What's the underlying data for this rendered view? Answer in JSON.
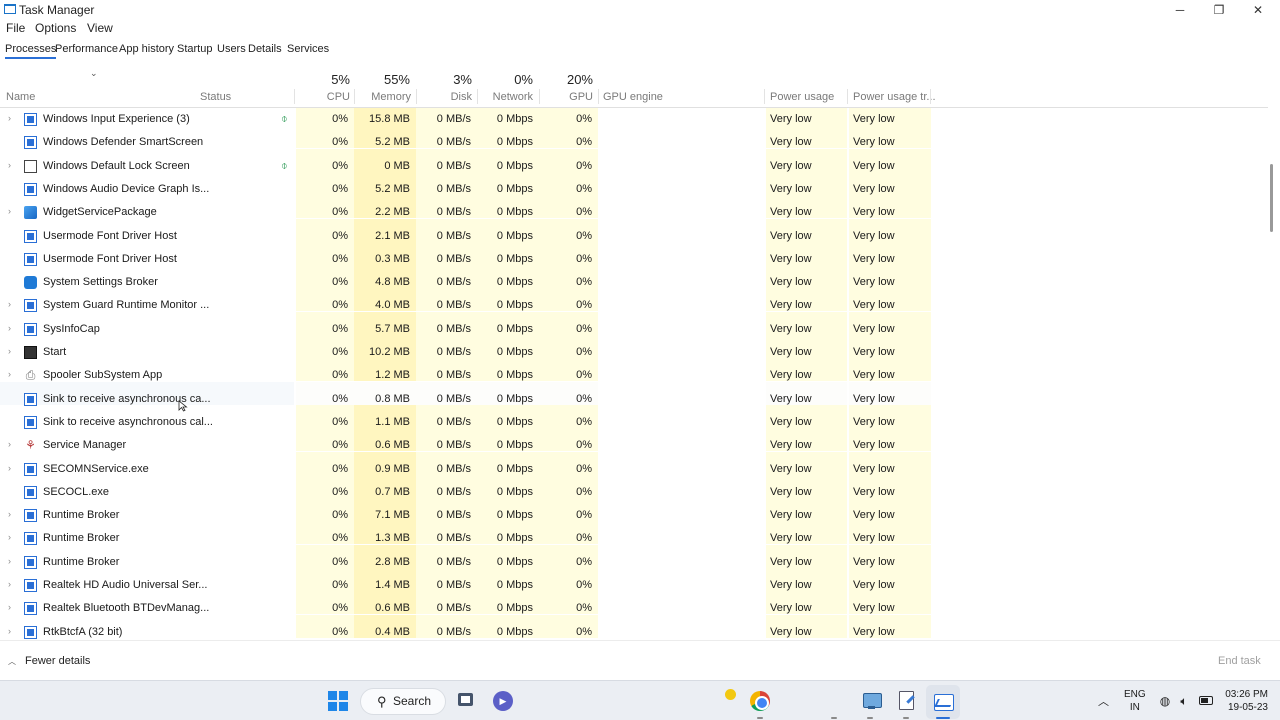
{
  "window": {
    "title": "Task Manager",
    "controls": {
      "minimize": "─",
      "restore": "❐",
      "close": "✕"
    }
  },
  "menu": [
    "File",
    "Options",
    "View"
  ],
  "tabs": [
    "Processes",
    "Performance",
    "App history",
    "Startup",
    "Users",
    "Details",
    "Services"
  ],
  "active_tab": "Processes",
  "columns": {
    "name": "Name",
    "status": "Status",
    "cpu": {
      "pct": "5%",
      "label": "CPU"
    },
    "memory": {
      "pct": "55%",
      "label": "Memory"
    },
    "disk": {
      "pct": "3%",
      "label": "Disk"
    },
    "network": {
      "pct": "0%",
      "label": "Network"
    },
    "gpu": {
      "pct": "20%",
      "label": "GPU"
    },
    "gpu_engine": "GPU engine",
    "power": "Power usage",
    "power_trend": "Power usage tr..."
  },
  "processes": [
    {
      "name": "Windows Input Experience (3)",
      "icon": "app-window-icon",
      "expandable": true,
      "efficiency": true,
      "cpu": "0%",
      "memory": "15.8 MB",
      "disk": "0 MB/s",
      "network": "0 Mbps",
      "gpu": "0%",
      "power": "Very low",
      "power_trend": "Very low"
    },
    {
      "name": "Windows Defender SmartScreen",
      "icon": "app-window-icon",
      "expandable": false,
      "efficiency": false,
      "cpu": "0%",
      "memory": "5.2 MB",
      "disk": "0 MB/s",
      "network": "0 Mbps",
      "gpu": "0%",
      "power": "Very low",
      "power_trend": "Very low"
    },
    {
      "name": "Windows Default Lock Screen",
      "icon": "lock-screen-icon",
      "expandable": true,
      "efficiency": true,
      "cpu": "0%",
      "memory": "0 MB",
      "disk": "0 MB/s",
      "network": "0 Mbps",
      "gpu": "0%",
      "power": "Very low",
      "power_trend": "Very low"
    },
    {
      "name": "Windows Audio Device Graph Is...",
      "icon": "app-window-icon",
      "expandable": false,
      "efficiency": false,
      "cpu": "0%",
      "memory": "5.2 MB",
      "disk": "0 MB/s",
      "network": "0 Mbps",
      "gpu": "0%",
      "power": "Very low",
      "power_trend": "Very low"
    },
    {
      "name": "WidgetServicePackage",
      "icon": "widget-icon",
      "expandable": true,
      "efficiency": false,
      "cpu": "0%",
      "memory": "2.2 MB",
      "disk": "0 MB/s",
      "network": "0 Mbps",
      "gpu": "0%",
      "power": "Very low",
      "power_trend": "Very low"
    },
    {
      "name": "Usermode Font Driver Host",
      "icon": "app-window-icon",
      "expandable": false,
      "efficiency": false,
      "cpu": "0%",
      "memory": "2.1 MB",
      "disk": "0 MB/s",
      "network": "0 Mbps",
      "gpu": "0%",
      "power": "Very low",
      "power_trend": "Very low"
    },
    {
      "name": "Usermode Font Driver Host",
      "icon": "app-window-icon",
      "expandable": false,
      "efficiency": false,
      "cpu": "0%",
      "memory": "0.3 MB",
      "disk": "0 MB/s",
      "network": "0 Mbps",
      "gpu": "0%",
      "power": "Very low",
      "power_trend": "Very low"
    },
    {
      "name": "System Settings Broker",
      "icon": "settings-gear-icon",
      "expandable": false,
      "efficiency": false,
      "cpu": "0%",
      "memory": "4.8 MB",
      "disk": "0 MB/s",
      "network": "0 Mbps",
      "gpu": "0%",
      "power": "Very low",
      "power_trend": "Very low"
    },
    {
      "name": "System Guard Runtime Monitor ...",
      "icon": "app-window-icon",
      "expandable": true,
      "efficiency": false,
      "cpu": "0%",
      "memory": "4.0 MB",
      "disk": "0 MB/s",
      "network": "0 Mbps",
      "gpu": "0%",
      "power": "Very low",
      "power_trend": "Very low"
    },
    {
      "name": "SysInfoCap",
      "icon": "app-window-icon",
      "expandable": true,
      "efficiency": false,
      "cpu": "0%",
      "memory": "5.7 MB",
      "disk": "0 MB/s",
      "network": "0 Mbps",
      "gpu": "0%",
      "power": "Very low",
      "power_trend": "Very low"
    },
    {
      "name": "Start",
      "icon": "start-icon",
      "expandable": true,
      "efficiency": false,
      "cpu": "0%",
      "memory": "10.2 MB",
      "disk": "0 MB/s",
      "network": "0 Mbps",
      "gpu": "0%",
      "power": "Very low",
      "power_trend": "Very low"
    },
    {
      "name": "Spooler SubSystem App",
      "icon": "printer-icon",
      "expandable": true,
      "efficiency": false,
      "cpu": "0%",
      "memory": "1.2 MB",
      "disk": "0 MB/s",
      "network": "0 Mbps",
      "gpu": "0%",
      "power": "Very low",
      "power_trend": "Very low"
    },
    {
      "name": "Sink to receive asynchronous ca...",
      "icon": "app-window-icon",
      "expandable": false,
      "efficiency": false,
      "selected": true,
      "cpu": "0%",
      "memory": "0.8 MB",
      "disk": "0 MB/s",
      "network": "0 Mbps",
      "gpu": "0%",
      "power": "Very low",
      "power_trend": "Very low"
    },
    {
      "name": "Sink to receive asynchronous cal...",
      "icon": "app-window-icon",
      "expandable": false,
      "efficiency": false,
      "cpu": "0%",
      "memory": "1.1 MB",
      "disk": "0 MB/s",
      "network": "0 Mbps",
      "gpu": "0%",
      "power": "Very low",
      "power_trend": "Very low"
    },
    {
      "name": "Service Manager",
      "icon": "service-manager-icon",
      "expandable": true,
      "efficiency": false,
      "cpu": "0%",
      "memory": "0.6 MB",
      "disk": "0 MB/s",
      "network": "0 Mbps",
      "gpu": "0%",
      "power": "Very low",
      "power_trend": "Very low"
    },
    {
      "name": "SECOMNService.exe",
      "icon": "app-window-icon",
      "expandable": true,
      "efficiency": false,
      "cpu": "0%",
      "memory": "0.9 MB",
      "disk": "0 MB/s",
      "network": "0 Mbps",
      "gpu": "0%",
      "power": "Very low",
      "power_trend": "Very low"
    },
    {
      "name": "SECOCL.exe",
      "icon": "app-window-icon",
      "expandable": false,
      "efficiency": false,
      "cpu": "0%",
      "memory": "0.7 MB",
      "disk": "0 MB/s",
      "network": "0 Mbps",
      "gpu": "0%",
      "power": "Very low",
      "power_trend": "Very low"
    },
    {
      "name": "Runtime Broker",
      "icon": "app-window-icon",
      "expandable": true,
      "efficiency": false,
      "cpu": "0%",
      "memory": "7.1 MB",
      "disk": "0 MB/s",
      "network": "0 Mbps",
      "gpu": "0%",
      "power": "Very low",
      "power_trend": "Very low"
    },
    {
      "name": "Runtime Broker",
      "icon": "app-window-icon",
      "expandable": true,
      "efficiency": false,
      "cpu": "0%",
      "memory": "1.3 MB",
      "disk": "0 MB/s",
      "network": "0 Mbps",
      "gpu": "0%",
      "power": "Very low",
      "power_trend": "Very low"
    },
    {
      "name": "Runtime Broker",
      "icon": "app-window-icon",
      "expandable": true,
      "efficiency": false,
      "cpu": "0%",
      "memory": "2.8 MB",
      "disk": "0 MB/s",
      "network": "0 Mbps",
      "gpu": "0%",
      "power": "Very low",
      "power_trend": "Very low"
    },
    {
      "name": "Realtek HD Audio Universal Ser...",
      "icon": "app-window-icon",
      "expandable": true,
      "efficiency": false,
      "cpu": "0%",
      "memory": "1.4 MB",
      "disk": "0 MB/s",
      "network": "0 Mbps",
      "gpu": "0%",
      "power": "Very low",
      "power_trend": "Very low"
    },
    {
      "name": "Realtek Bluetooth BTDevManag...",
      "icon": "app-window-icon",
      "expandable": true,
      "efficiency": false,
      "cpu": "0%",
      "memory": "0.6 MB",
      "disk": "0 MB/s",
      "network": "0 Mbps",
      "gpu": "0%",
      "power": "Very low",
      "power_trend": "Very low"
    },
    {
      "name": "RtkBtcfA (32 bit)",
      "icon": "app-window-icon",
      "expandable": true,
      "efficiency": false,
      "cpu": "0%",
      "memory": "0.4 MB",
      "disk": "0 MB/s",
      "network": "0 Mbps",
      "gpu": "0%",
      "power": "Very low",
      "power_trend": "Very low"
    }
  ],
  "footer": {
    "fewer_details": "Fewer details",
    "end_task": "End task"
  },
  "taskbar": {
    "search_label": "Search",
    "lang_line1": "ENG",
    "lang_line2": "IN",
    "time": "03:26 PM",
    "date": "19-05-23"
  }
}
